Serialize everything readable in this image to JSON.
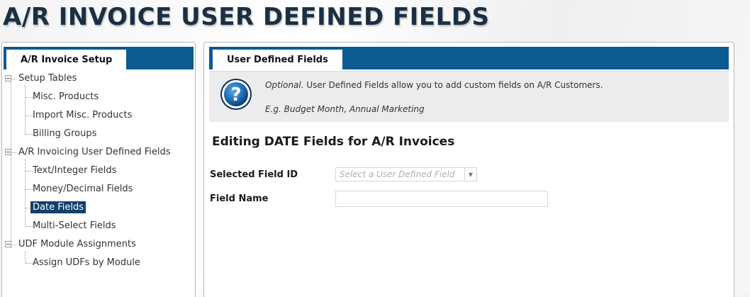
{
  "page": {
    "title": "A/R INVOICE USER DEFINED FIELDS"
  },
  "left_panel": {
    "tab_label": "A/R Invoice Setup",
    "tree": {
      "setup_tables": "Setup Tables",
      "misc_products": "Misc. Products",
      "import_misc_products": "Import Misc. Products",
      "billing_groups": "Billing Groups",
      "ar_invoicing_udf": "A/R Invoicing User Defined Fields",
      "text_integer_fields": "Text/Integer Fields",
      "money_decimal_fields": "Money/Decimal Fields",
      "date_fields": "Date Fields",
      "multi_select_fields": "Multi-Select Fields",
      "udf_module_assignments": "UDF Module Assignments",
      "assign_udfs_by_module": "Assign UDFs by Module"
    },
    "selected_item": "Date Fields"
  },
  "right_panel": {
    "tab_label": "User Defined Fields",
    "info": {
      "optional_word": "Optional.",
      "description": " User Defined Fields allow you to add custom fields on A/R Customers.",
      "example": "E.g. Budget Month, Annual Marketing"
    },
    "section_title": "Editing DATE Fields for A/R Invoices",
    "form": {
      "selected_field_id_label": "Selected Field ID",
      "selected_field_id_placeholder": "Select a User Defined Field",
      "field_name_label": "Field Name",
      "field_name_value": ""
    }
  },
  "colors": {
    "tab_bar": "#0d5a91",
    "selected_item_bg": "#123f6c",
    "title_color": "#1b2f44",
    "info_bg": "#ececec"
  },
  "icons": {
    "help": "question-mark-circle-icon",
    "tree_expander": "tree-collapse-icon",
    "dropdown": "chevron-down-icon"
  }
}
